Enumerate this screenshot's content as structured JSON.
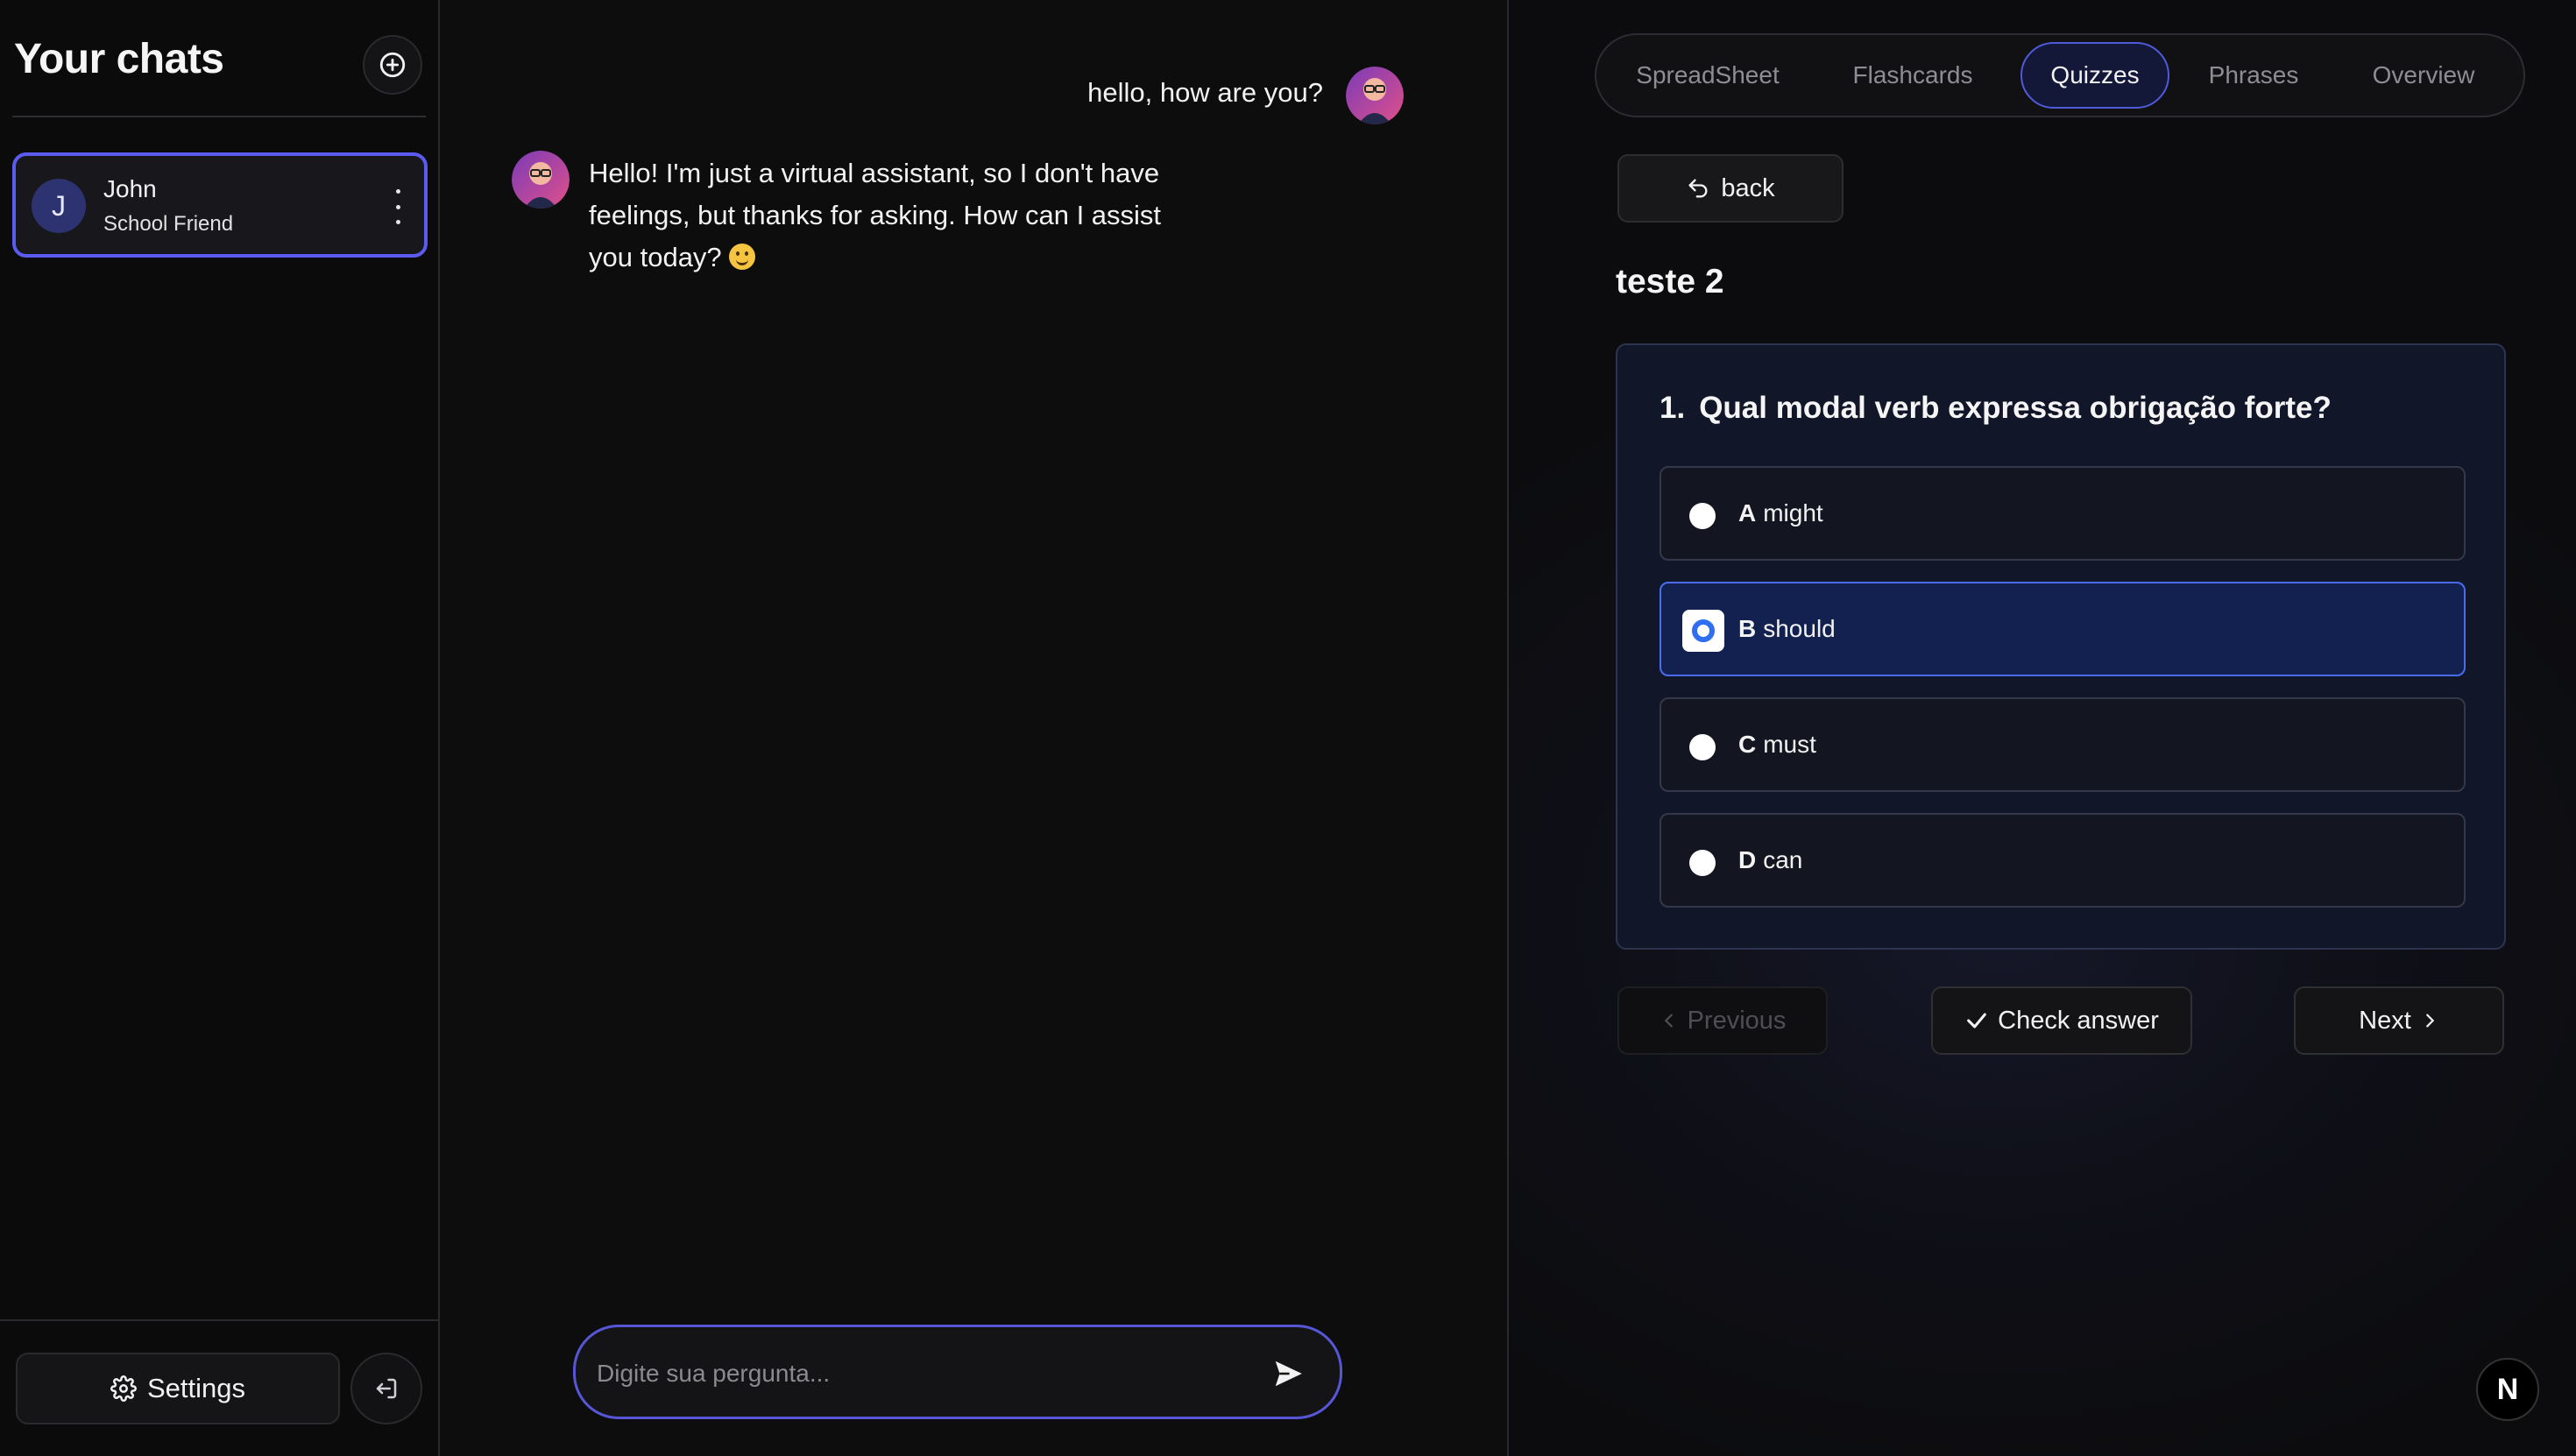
{
  "sidebar": {
    "title": "Your chats",
    "chats": [
      {
        "initial": "J",
        "name": "John",
        "subtitle": "School Friend"
      }
    ],
    "settings_label": "Settings"
  },
  "chat": {
    "messages": [
      {
        "role": "user",
        "text": "hello, how are you?"
      },
      {
        "role": "assistant",
        "text": "Hello! I'm just a virtual assistant, so I don't have feelings, but thanks for asking. How can I assist you today?"
      }
    ],
    "input_placeholder": "Digite sua pergunta..."
  },
  "tabs": {
    "items": [
      "SpreadSheet",
      "Flashcards",
      "Quizzes",
      "Phrases",
      "Overview"
    ],
    "active": "Quizzes"
  },
  "quiz": {
    "back_label": "back",
    "title": "teste 2",
    "question_number": "1.",
    "question": "Qual modal verb expressa obrigação forte?",
    "options": [
      {
        "letter": "A",
        "text": "might"
      },
      {
        "letter": "B",
        "text": "should"
      },
      {
        "letter": "C",
        "text": "must"
      },
      {
        "letter": "D",
        "text": "can"
      }
    ],
    "selected": "B",
    "previous_label": "Previous",
    "check_label": "Check answer",
    "next_label": "Next"
  },
  "badge_label": "N",
  "colors": {
    "accent": "#5b5bf0",
    "selected_option_border": "#4a6cf0",
    "background": "#0c0c0d"
  },
  "icons": [
    "plus-circle-icon",
    "more-vertical-icon",
    "gear-icon",
    "logout-icon",
    "send-icon",
    "undo-arrow-icon",
    "chevron-left-icon",
    "check-icon",
    "chevron-right-icon"
  ]
}
